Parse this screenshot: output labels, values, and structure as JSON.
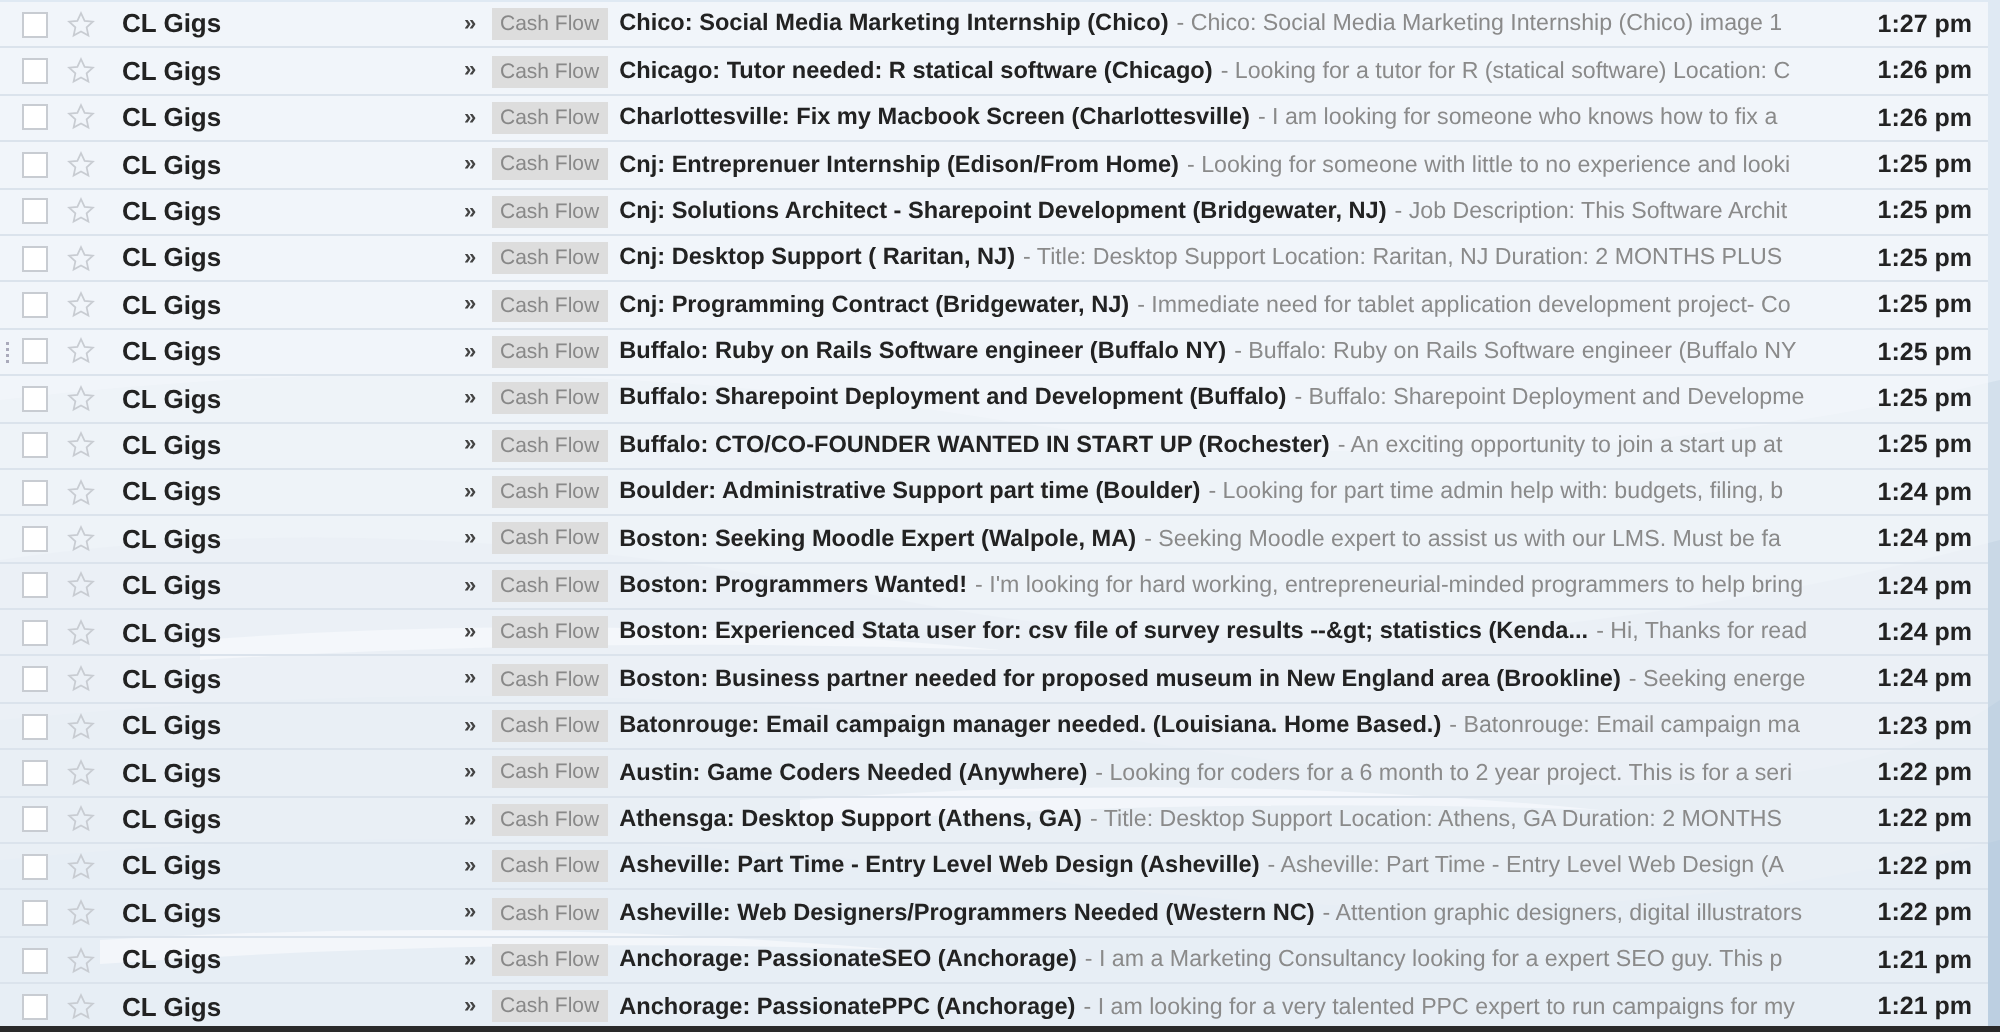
{
  "rows": [
    {
      "checked": false,
      "starred": false,
      "grip": false,
      "sender": "CL Gigs",
      "arrow": "»",
      "label": "Cash Flow",
      "subject": "Chico: Social Media Marketing Internship (Chico)",
      "snippet": "- Chico: Social Media Marketing Internship (Chico) image 1",
      "time": "1:27 pm"
    },
    {
      "checked": false,
      "starred": false,
      "grip": false,
      "sender": "CL Gigs",
      "arrow": "»",
      "label": "Cash Flow",
      "subject": "Chicago: Tutor needed: R statical software (Chicago)",
      "snippet": "- Looking for a tutor for R (statical software) Location: C",
      "time": "1:26 pm"
    },
    {
      "checked": false,
      "starred": false,
      "grip": false,
      "sender": "CL Gigs",
      "arrow": "»",
      "label": "Cash Flow",
      "subject": "Charlottesville: Fix my Macbook Screen (Charlottesville)",
      "snippet": "- I am looking for someone who knows how to fix a",
      "time": "1:26 pm"
    },
    {
      "checked": false,
      "starred": false,
      "grip": false,
      "sender": "CL Gigs",
      "arrow": "»",
      "label": "Cash Flow",
      "subject": "Cnj: Entreprenuer Internship (Edison/From Home)",
      "snippet": "- Looking for someone with little to no experience and looki",
      "time": "1:25 pm"
    },
    {
      "checked": false,
      "starred": false,
      "grip": false,
      "sender": "CL Gigs",
      "arrow": "»",
      "label": "Cash Flow",
      "subject": "Cnj: Solutions Architect - Sharepoint Development (Bridgewater, NJ)",
      "snippet": "- Job Description: This Software Archit",
      "time": "1:25 pm"
    },
    {
      "checked": false,
      "starred": false,
      "grip": false,
      "sender": "CL Gigs",
      "arrow": "»",
      "label": "Cash Flow",
      "subject": "Cnj: Desktop Support ( Raritan, NJ)",
      "snippet": "- Title: Desktop Support Location: Raritan, NJ Duration: 2 MONTHS PLUS",
      "time": "1:25 pm"
    },
    {
      "checked": false,
      "starred": false,
      "grip": false,
      "sender": "CL Gigs",
      "arrow": "»",
      "label": "Cash Flow",
      "subject": "Cnj: Programming Contract (Bridgewater, NJ)",
      "snippet": "- Immediate need for tablet application development project- Co",
      "time": "1:25 pm"
    },
    {
      "checked": false,
      "starred": false,
      "grip": true,
      "sender": "CL Gigs",
      "arrow": "»",
      "label": "Cash Flow",
      "subject": "Buffalo: Ruby on Rails Software engineer (Buffalo NY)",
      "snippet": "- Buffalo: Ruby on Rails Software engineer (Buffalo NY",
      "time": "1:25 pm"
    },
    {
      "checked": false,
      "starred": false,
      "grip": false,
      "sender": "CL Gigs",
      "arrow": "»",
      "label": "Cash Flow",
      "subject": "Buffalo: Sharepoint Deployment and Development (Buffalo)",
      "snippet": "- Buffalo: Sharepoint Deployment and Developme",
      "time": "1:25 pm"
    },
    {
      "checked": false,
      "starred": false,
      "grip": false,
      "sender": "CL Gigs",
      "arrow": "»",
      "label": "Cash Flow",
      "subject": "Buffalo: CTO/CO-FOUNDER WANTED IN START UP (Rochester)",
      "snippet": "- An exciting opportunity to join a start up at",
      "time": "1:25 pm"
    },
    {
      "checked": false,
      "starred": false,
      "grip": false,
      "sender": "CL Gigs",
      "arrow": "»",
      "label": "Cash Flow",
      "subject": "Boulder: Administrative Support part time (Boulder)",
      "snippet": "- Looking for part time admin help with: budgets, filing, b",
      "time": "1:24 pm"
    },
    {
      "checked": false,
      "starred": false,
      "grip": false,
      "sender": "CL Gigs",
      "arrow": "»",
      "label": "Cash Flow",
      "subject": "Boston: Seeking Moodle Expert (Walpole, MA)",
      "snippet": "- Seeking Moodle expert to assist us with our LMS. Must be fa",
      "time": "1:24 pm"
    },
    {
      "checked": false,
      "starred": false,
      "grip": false,
      "sender": "CL Gigs",
      "arrow": "»",
      "label": "Cash Flow",
      "subject": "Boston: Programmers Wanted!",
      "snippet": "- I'm looking for hard working, entrepreneurial-minded programmers to help bring",
      "time": "1:24 pm"
    },
    {
      "checked": false,
      "starred": false,
      "grip": false,
      "sender": "CL Gigs",
      "arrow": "»",
      "label": "Cash Flow",
      "subject": "Boston: Experienced Stata user for: csv file of survey results --&gt; statistics (Kenda...",
      "snippet": "- Hi, Thanks for read",
      "time": "1:24 pm"
    },
    {
      "checked": false,
      "starred": false,
      "grip": false,
      "sender": "CL Gigs",
      "arrow": "»",
      "label": "Cash Flow",
      "subject": "Boston: Business partner needed for proposed museum in New England area (Brookline)",
      "snippet": "- Seeking energe",
      "time": "1:24 pm"
    },
    {
      "checked": false,
      "starred": false,
      "grip": false,
      "sender": "CL Gigs",
      "arrow": "»",
      "label": "Cash Flow",
      "subject": "Batonrouge: Email campaign manager needed. (Louisiana. Home Based.)",
      "snippet": "- Batonrouge: Email campaign ma",
      "time": "1:23 pm"
    },
    {
      "checked": false,
      "starred": false,
      "grip": false,
      "sender": "CL Gigs",
      "arrow": "»",
      "label": "Cash Flow",
      "subject": "Austin: Game Coders Needed (Anywhere)",
      "snippet": "- Looking for coders for a 6 month to 2 year project. This is for a seri",
      "time": "1:22 pm"
    },
    {
      "checked": false,
      "starred": false,
      "grip": false,
      "sender": "CL Gigs",
      "arrow": "»",
      "label": "Cash Flow",
      "subject": "Athensga: Desktop Support (Athens, GA)",
      "snippet": "- Title: Desktop Support Location: Athens, GA Duration: 2 MONTHS",
      "time": "1:22 pm"
    },
    {
      "checked": false,
      "starred": false,
      "grip": false,
      "sender": "CL Gigs",
      "arrow": "»",
      "label": "Cash Flow",
      "subject": "Asheville: Part Time - Entry Level Web Design (Asheville)",
      "snippet": "- Asheville: Part Time - Entry Level Web Design (A",
      "time": "1:22 pm"
    },
    {
      "checked": false,
      "starred": false,
      "grip": false,
      "sender": "CL Gigs",
      "arrow": "»",
      "label": "Cash Flow",
      "subject": "Asheville: Web Designers/Programmers Needed (Western NC)",
      "snippet": "- Attention graphic designers, digital illustrators",
      "time": "1:22 pm"
    },
    {
      "checked": false,
      "starred": false,
      "grip": false,
      "sender": "CL Gigs",
      "arrow": "»",
      "label": "Cash Flow",
      "subject": "Anchorage: PassionateSEO (Anchorage)",
      "snippet": "- I am a Marketing Consultancy looking for a expert SEO guy. This p",
      "time": "1:21 pm"
    },
    {
      "checked": false,
      "starred": false,
      "grip": false,
      "sender": "CL Gigs",
      "arrow": "»",
      "label": "Cash Flow",
      "subject": "Anchorage: PassionatePPC (Anchorage)",
      "snippet": "- I am looking for a very talented PPC expert to run campaigns for my",
      "time": "1:21 pm"
    }
  ]
}
